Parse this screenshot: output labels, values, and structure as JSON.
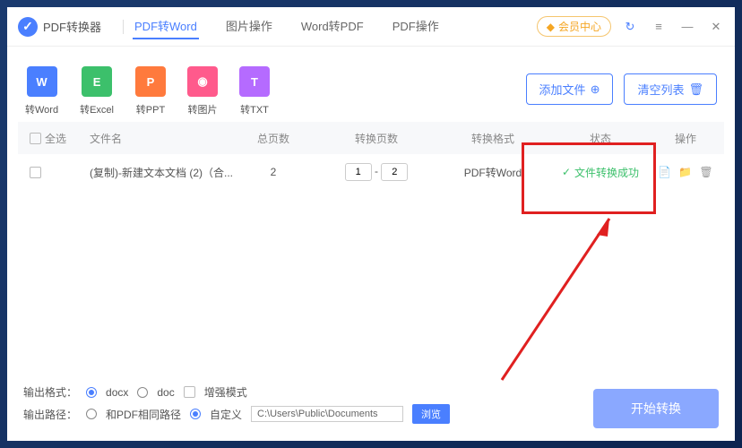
{
  "app": {
    "title": "PDF转换器"
  },
  "tabs": {
    "t0": "PDF转Word",
    "t1": "图片操作",
    "t2": "Word转PDF",
    "t3": "PDF操作"
  },
  "vip": {
    "label": "会员中心"
  },
  "formats": {
    "f0": {
      "ico": "W",
      "label": "转Word",
      "color": "#4a7fff"
    },
    "f1": {
      "ico": "E",
      "label": "转Excel",
      "color": "#3cc06b"
    },
    "f2": {
      "ico": "P",
      "label": "转PPT",
      "color": "#ff7a3d"
    },
    "f3": {
      "ico": "◉",
      "label": "转图片",
      "color": "#ff5a8c"
    },
    "f4": {
      "ico": "T",
      "label": "转TXT",
      "color": "#b56bff"
    }
  },
  "buttons": {
    "add": "添加文件",
    "clear": "清空列表",
    "start": "开始转换",
    "browse": "浏览"
  },
  "columns": {
    "sel": "全选",
    "name": "文件名",
    "pages": "总页数",
    "conv": "转换页数",
    "fmt": "转换格式",
    "status": "状态",
    "ops": "操作"
  },
  "row": {
    "name": "(复制)-新建文本文档 (2)（合...",
    "pages": "2",
    "from": "1",
    "to": "2",
    "fmt": "PDF转Word",
    "status": "文件转换成功"
  },
  "footer": {
    "fmtLabel": "输出格式：",
    "opt_docx": "docx",
    "opt_doc": "doc",
    "opt_enh": "增强模式",
    "pathLabel": "输出路径：",
    "opt_same": "和PDF相同路径",
    "opt_custom": "自定义",
    "path": "C:\\Users\\Public\\Documents"
  }
}
